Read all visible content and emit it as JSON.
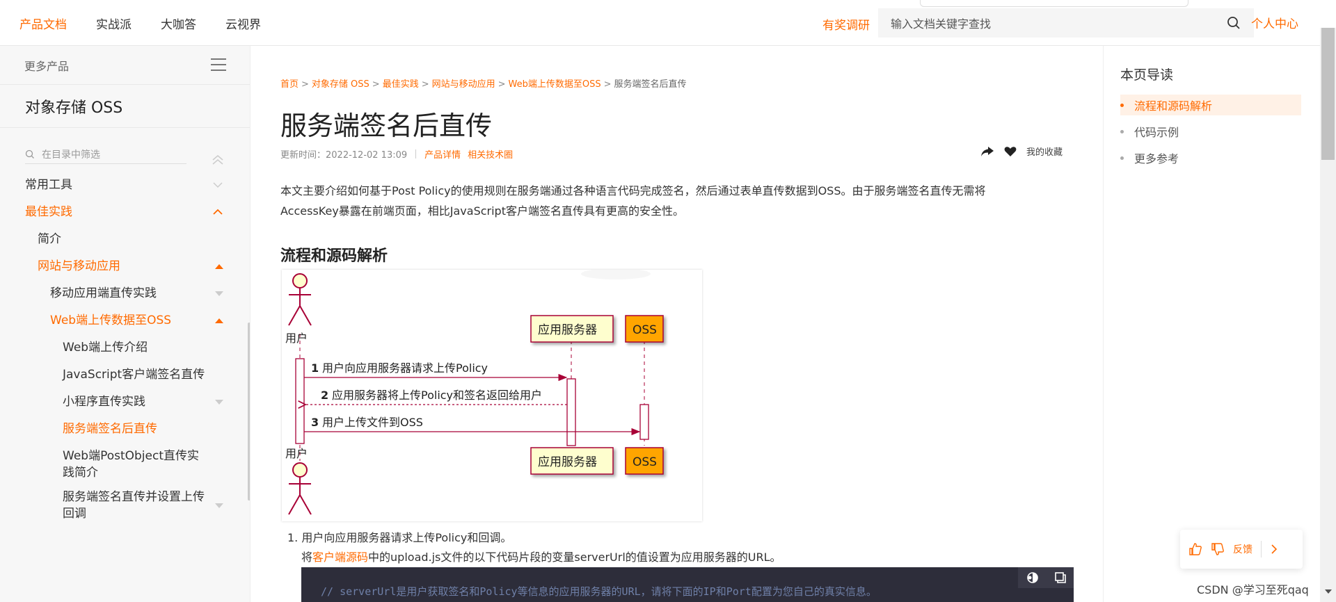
{
  "topbar": {
    "nav": [
      "产品文档",
      "实战派",
      "大咖答",
      "云视界"
    ],
    "survey": "有奖调研",
    "search_placeholder": "输入文档关键字查找",
    "user_center": "个人中心"
  },
  "sidebar": {
    "more_products": "更多产品",
    "product_title": "对象存储 OSS",
    "filter_placeholder": "在目录中筛选",
    "items": [
      {
        "label": "常用工具",
        "state": "collapsed"
      },
      {
        "label": "最佳实践",
        "state": "expanded"
      },
      {
        "label": "简介"
      },
      {
        "label": "网站与移动应用",
        "state": "expanded"
      },
      {
        "label": "移动应用端直传实践",
        "state": "collapsed"
      },
      {
        "label": "Web端上传数据至OSS",
        "state": "expanded"
      },
      {
        "label": "Web端上传介绍"
      },
      {
        "label": "JavaScript客户端签名直传"
      },
      {
        "label": "小程序直传实践",
        "state": "collapsed"
      },
      {
        "label": "服务端签名后直传",
        "state": "selected"
      },
      {
        "label": "Web端PostObject直传实践简介"
      },
      {
        "label": "服务端签名直传并设置上传回调",
        "state": "collapsed"
      }
    ]
  },
  "breadcrumb": {
    "items": [
      "首页",
      "对象存储 OSS",
      "最佳实践",
      "网站与移动应用",
      "Web端上传数据至OSS"
    ],
    "current": "服务端签名后直传"
  },
  "page": {
    "title": "服务端签名后直传",
    "updated": "更新时间：2022-12-02 13:09",
    "product_link": "产品详情",
    "community_link": "相关技术圈",
    "favorite": "我的收藏",
    "intro": "本文主要介绍如何基于Post Policy的使用规则在服务端通过各种语言代码完成签名，然后通过表单直传数据到OSS。由于服务端签名直传无需将AccessKey暴露在前端页面，相比JavaScript客户端签名直传具有更高的安全性。",
    "section_title": "流程和源码解析",
    "step1": "1. 用户向应用服务器请求上传Policy和回调。",
    "step1_detail_pre": "将",
    "step1_detail_link": "客户端源码",
    "step1_detail_post": "中的upload.js文件的以下代码片段的变量serverUrl的值设置为应用服务器的URL。",
    "code_line": "// serverUrl是用户获取签名和Policy等信息的应用服务器的URL，请将下面的IP和Port配置为您自己的真实信息。"
  },
  "diagram": {
    "actor_top": "用户",
    "actor_bottom": "用户",
    "app_server": "应用服务器",
    "oss": "OSS",
    "msg1_num": "1",
    "msg1": "用户向应用服务器请求上传Policy",
    "msg2_num": "2",
    "msg2": "应用服务器将上传Policy和签名返回给用户",
    "msg3_num": "3",
    "msg3": "用户上传文件到OSS",
    "colors": {
      "line": "#a80036",
      "app_box": "#fefece",
      "oss_box": "#ffa500"
    }
  },
  "toc": {
    "title": "本页导读",
    "items": [
      "流程和源码解析",
      "代码示例",
      "更多参考"
    ]
  },
  "feedback": {
    "label": "反馈"
  },
  "watermark": "CSDN @学习至死qaq",
  "colors": {
    "accent": "#ff6a00"
  }
}
